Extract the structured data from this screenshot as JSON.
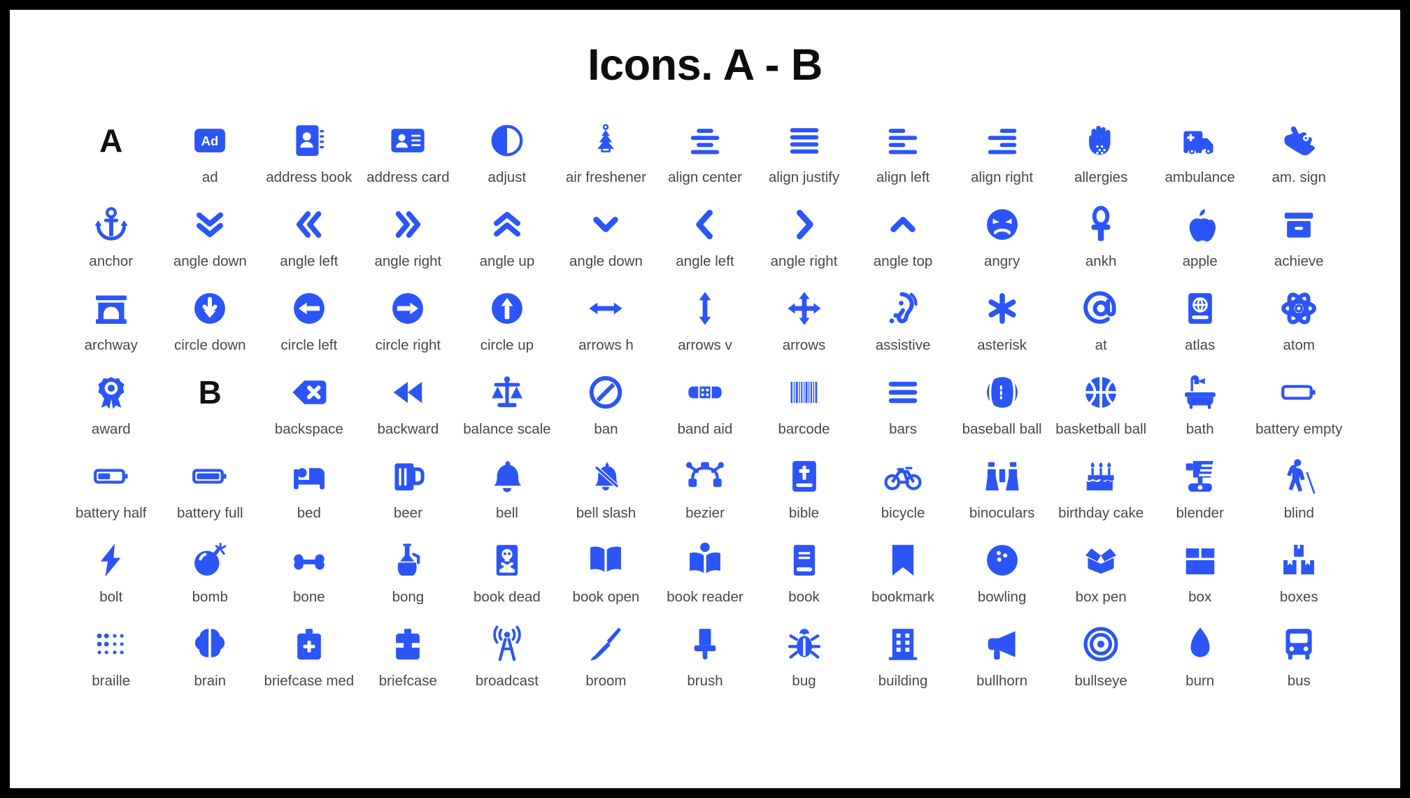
{
  "page": {
    "title": "Icons. A - B",
    "background": "#000000",
    "sheet_background": "#ffffff",
    "icon_color": "#2b55f7",
    "caption_color": "#474747",
    "letter_color": "#111111",
    "columns": 13,
    "rows": 7
  },
  "cells": [
    {
      "type": "letter",
      "label": "A",
      "icon": "letter-a"
    },
    {
      "type": "icon",
      "label": "ad",
      "icon": "ad-icon"
    },
    {
      "type": "icon",
      "label": "address book",
      "icon": "address-book-icon"
    },
    {
      "type": "icon",
      "label": "address card",
      "icon": "address-card-icon"
    },
    {
      "type": "icon",
      "label": "adjust",
      "icon": "adjust-icon"
    },
    {
      "type": "icon",
      "label": "air freshener",
      "icon": "air-freshener-icon"
    },
    {
      "type": "icon",
      "label": "align center",
      "icon": "align-center-icon"
    },
    {
      "type": "icon",
      "label": "align justify",
      "icon": "align-justify-icon"
    },
    {
      "type": "icon",
      "label": "align left",
      "icon": "align-left-icon"
    },
    {
      "type": "icon",
      "label": "align right",
      "icon": "align-right-icon"
    },
    {
      "type": "icon",
      "label": "allergies",
      "icon": "allergies-icon"
    },
    {
      "type": "icon",
      "label": "ambulance",
      "icon": "ambulance-icon"
    },
    {
      "type": "icon",
      "label": "am. sign",
      "icon": "american-sign-language-icon"
    },
    {
      "type": "icon",
      "label": "anchor",
      "icon": "anchor-icon"
    },
    {
      "type": "icon",
      "label": "angle down",
      "icon": "angle-double-down-icon"
    },
    {
      "type": "icon",
      "label": "angle left",
      "icon": "angle-double-left-icon"
    },
    {
      "type": "icon",
      "label": "angle right",
      "icon": "angle-double-right-icon"
    },
    {
      "type": "icon",
      "label": "angle up",
      "icon": "angle-double-up-icon"
    },
    {
      "type": "icon",
      "label": "angle down",
      "icon": "angle-down-icon"
    },
    {
      "type": "icon",
      "label": "angle left",
      "icon": "angle-left-icon"
    },
    {
      "type": "icon",
      "label": "angle right",
      "icon": "angle-right-icon"
    },
    {
      "type": "icon",
      "label": "angle top",
      "icon": "angle-up-icon"
    },
    {
      "type": "icon",
      "label": "angry",
      "icon": "angry-face-icon"
    },
    {
      "type": "icon",
      "label": "ankh",
      "icon": "ankh-icon"
    },
    {
      "type": "icon",
      "label": "apple",
      "icon": "apple-icon"
    },
    {
      "type": "icon",
      "label": "achieve",
      "icon": "archive-box-icon"
    },
    {
      "type": "icon",
      "label": "archway",
      "icon": "archway-icon"
    },
    {
      "type": "icon",
      "label": "circle down",
      "icon": "arrow-circle-down-icon"
    },
    {
      "type": "icon",
      "label": "circle left",
      "icon": "arrow-circle-left-icon"
    },
    {
      "type": "icon",
      "label": "circle right",
      "icon": "arrow-circle-right-icon"
    },
    {
      "type": "icon",
      "label": "circle up",
      "icon": "arrow-circle-up-icon"
    },
    {
      "type": "icon",
      "label": "arrows h",
      "icon": "arrows-horizontal-icon"
    },
    {
      "type": "icon",
      "label": "arrows v",
      "icon": "arrows-vertical-icon"
    },
    {
      "type": "icon",
      "label": "arrows",
      "icon": "arrows-move-icon"
    },
    {
      "type": "icon",
      "label": "assistive",
      "icon": "assistive-listening-icon"
    },
    {
      "type": "icon",
      "label": "asterisk",
      "icon": "asterisk-icon"
    },
    {
      "type": "icon",
      "label": "at",
      "icon": "at-sign-icon"
    },
    {
      "type": "icon",
      "label": "atlas",
      "icon": "atlas-icon"
    },
    {
      "type": "icon",
      "label": "atom",
      "icon": "atom-icon"
    },
    {
      "type": "icon",
      "label": "award",
      "icon": "award-icon"
    },
    {
      "type": "letter",
      "label": "B",
      "icon": "letter-b"
    },
    {
      "type": "icon",
      "label": "backspace",
      "icon": "backspace-icon"
    },
    {
      "type": "icon",
      "label": "backward",
      "icon": "backward-icon"
    },
    {
      "type": "icon",
      "label": "balance scale",
      "icon": "balance-scale-icon"
    },
    {
      "type": "icon",
      "label": "ban",
      "icon": "ban-icon"
    },
    {
      "type": "icon",
      "label": "band aid",
      "icon": "band-aid-icon"
    },
    {
      "type": "icon",
      "label": "barcode",
      "icon": "barcode-icon"
    },
    {
      "type": "icon",
      "label": "bars",
      "icon": "bars-icon"
    },
    {
      "type": "icon",
      "label": "baseball ball",
      "icon": "baseball-ball-icon"
    },
    {
      "type": "icon",
      "label": "basketball ball",
      "icon": "basketball-ball-icon"
    },
    {
      "type": "icon",
      "label": "bath",
      "icon": "bath-icon"
    },
    {
      "type": "icon",
      "label": "battery empty",
      "icon": "battery-empty-icon"
    },
    {
      "type": "icon",
      "label": "battery half",
      "icon": "battery-half-icon"
    },
    {
      "type": "icon",
      "label": "battery full",
      "icon": "battery-full-icon"
    },
    {
      "type": "icon",
      "label": "bed",
      "icon": "bed-icon"
    },
    {
      "type": "icon",
      "label": "beer",
      "icon": "beer-mug-icon"
    },
    {
      "type": "icon",
      "label": "bell",
      "icon": "bell-icon"
    },
    {
      "type": "icon",
      "label": "bell slash",
      "icon": "bell-slash-icon"
    },
    {
      "type": "icon",
      "label": "bezier",
      "icon": "bezier-curve-icon"
    },
    {
      "type": "icon",
      "label": "bible",
      "icon": "bible-icon"
    },
    {
      "type": "icon",
      "label": "bicycle",
      "icon": "bicycle-icon"
    },
    {
      "type": "icon",
      "label": "binoculars",
      "icon": "binoculars-icon"
    },
    {
      "type": "icon",
      "label": "birthday cake",
      "icon": "birthday-cake-icon"
    },
    {
      "type": "icon",
      "label": "blender",
      "icon": "blender-icon"
    },
    {
      "type": "icon",
      "label": "blind",
      "icon": "blind-person-icon"
    },
    {
      "type": "icon",
      "label": "bolt",
      "icon": "bolt-icon"
    },
    {
      "type": "icon",
      "label": "bomb",
      "icon": "bomb-icon"
    },
    {
      "type": "icon",
      "label": "bone",
      "icon": "bone-icon"
    },
    {
      "type": "icon",
      "label": "bong",
      "icon": "bong-icon"
    },
    {
      "type": "icon",
      "label": "book dead",
      "icon": "book-dead-icon"
    },
    {
      "type": "icon",
      "label": "book open",
      "icon": "book-open-icon"
    },
    {
      "type": "icon",
      "label": "book reader",
      "icon": "book-reader-icon"
    },
    {
      "type": "icon",
      "label": "book",
      "icon": "book-icon"
    },
    {
      "type": "icon",
      "label": "bookmark",
      "icon": "bookmark-icon"
    },
    {
      "type": "icon",
      "label": "bowling",
      "icon": "bowling-ball-icon"
    },
    {
      "type": "icon",
      "label": "box pen",
      "icon": "box-open-icon"
    },
    {
      "type": "icon",
      "label": "box",
      "icon": "box-icon"
    },
    {
      "type": "icon",
      "label": "boxes",
      "icon": "boxes-icon"
    },
    {
      "type": "icon",
      "label": "braille",
      "icon": "braille-icon"
    },
    {
      "type": "icon",
      "label": "brain",
      "icon": "brain-icon"
    },
    {
      "type": "icon",
      "label": "briefcase med",
      "icon": "briefcase-medical-icon"
    },
    {
      "type": "icon",
      "label": "briefcase",
      "icon": "briefcase-icon"
    },
    {
      "type": "icon",
      "label": "broadcast",
      "icon": "broadcast-tower-icon"
    },
    {
      "type": "icon",
      "label": "broom",
      "icon": "broom-icon"
    },
    {
      "type": "icon",
      "label": "brush",
      "icon": "brush-icon"
    },
    {
      "type": "icon",
      "label": "bug",
      "icon": "bug-icon"
    },
    {
      "type": "icon",
      "label": "building",
      "icon": "building-icon"
    },
    {
      "type": "icon",
      "label": "bullhorn",
      "icon": "bullhorn-icon"
    },
    {
      "type": "icon",
      "label": "bullseye",
      "icon": "bullseye-icon"
    },
    {
      "type": "icon",
      "label": "burn",
      "icon": "burn-icon"
    },
    {
      "type": "icon",
      "label": "bus",
      "icon": "bus-icon"
    }
  ]
}
